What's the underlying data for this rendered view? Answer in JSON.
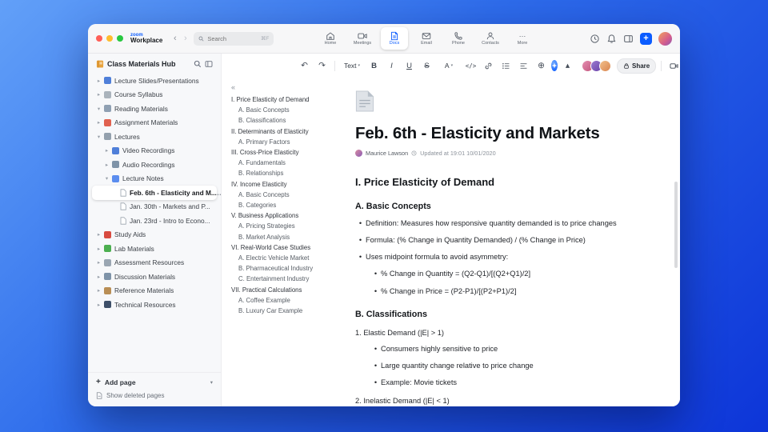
{
  "colors": {
    "accent": "#0b5cff"
  },
  "header": {
    "brand_top": "zoom",
    "brand_bottom": "Workplace",
    "search_placeholder": "Search",
    "search_shortcut": "⌘F"
  },
  "nav": {
    "items": [
      {
        "label": "Home"
      },
      {
        "label": "Meetings"
      },
      {
        "label": "Docs",
        "active": true
      },
      {
        "label": "Email"
      },
      {
        "label": "Phone"
      },
      {
        "label": "Contacts"
      },
      {
        "label": "More"
      }
    ]
  },
  "icons": {
    "chevron_right": "▸",
    "chevron_down": "▾",
    "chevron_up": "▴",
    "back": "‹",
    "forward": "›",
    "undo": "↶",
    "redo": "↷",
    "ellipsis": "…",
    "collapse_outline": "«",
    "plus": "+",
    "insert": "⊕",
    "bold": "B",
    "italic": "I",
    "underline": "U",
    "strike": "S",
    "font_color": "A",
    "code": "</>"
  },
  "sidebar": {
    "title": "Class Materials Hub",
    "items": [
      {
        "label": "Lecture Slides/Presentations",
        "icon": "presentation"
      },
      {
        "label": "Course Syllabus",
        "icon": "clipboard"
      },
      {
        "label": "Reading Materials",
        "icon": "book",
        "expanded": true
      },
      {
        "label": "Assignment Materials",
        "icon": "magnet"
      },
      {
        "label": "Lectures",
        "icon": "tag",
        "expanded": true
      },
      {
        "label": "Video Recordings",
        "icon": "video"
      },
      {
        "label": "Audio Recordings",
        "icon": "microphone"
      },
      {
        "label": "Lecture Notes",
        "icon": "note",
        "expanded": true
      },
      {
        "label": "Feb. 6th - Elasticity and M...",
        "icon": "page",
        "selected": true
      },
      {
        "label": "Jan. 30th - Markets and P...",
        "icon": "page"
      },
      {
        "label": "Jan. 23rd - Intro to Econo...",
        "icon": "page"
      },
      {
        "label": "Study Aids",
        "icon": "apple"
      },
      {
        "label": "Lab Materials",
        "icon": "pencil"
      },
      {
        "label": "Assessment Resources",
        "icon": "assessment"
      },
      {
        "label": "Discussion Materials",
        "icon": "discussion"
      },
      {
        "label": "Reference Materials",
        "icon": "reference"
      },
      {
        "label": "Technical Resources",
        "icon": "technical"
      }
    ],
    "add_page": "Add page",
    "show_deleted": "Show deleted pages"
  },
  "toolbar": {
    "text_style": "Text",
    "share": "Share"
  },
  "doc": {
    "title": "Feb. 6th - Elasticity and Markets",
    "author": "Maurice Lawson",
    "updated": "Updated at 19:01 10/01/2020"
  },
  "outline": {
    "items": [
      {
        "label": "I. Price Elasticity of Demand",
        "level": 1
      },
      {
        "label": "A. Basic Concepts",
        "level": 2
      },
      {
        "label": "B. Classifications",
        "level": 2
      },
      {
        "label": "II. Determinants of Elasticity",
        "level": 1
      },
      {
        "label": "A. Primary Factors",
        "level": 2
      },
      {
        "label": "III. Cross-Price Elasticity",
        "level": 1
      },
      {
        "label": "A. Fundamentals",
        "level": 2
      },
      {
        "label": "B. Relationships",
        "level": 2
      },
      {
        "label": "IV. Income Elasticity",
        "level": 1
      },
      {
        "label": "A. Basic Concepts",
        "level": 2
      },
      {
        "label": "B. Categories",
        "level": 2
      },
      {
        "label": "V. Business Applications",
        "level": 1
      },
      {
        "label": "A. Pricing Strategies",
        "level": 2
      },
      {
        "label": "B. Market Analysis",
        "level": 2
      },
      {
        "label": "VI. Real-World Case Studies",
        "level": 1
      },
      {
        "label": "A. Electric Vehicle Market",
        "level": 2
      },
      {
        "label": "B. Pharmaceutical Industry",
        "level": 2
      },
      {
        "label": "C. Entertainment Industry",
        "level": 2
      },
      {
        "label": "VII. Practical Calculations",
        "level": 1
      },
      {
        "label": "A. Coffee Example",
        "level": 2
      },
      {
        "label": "B. Luxury Car Example",
        "level": 2
      }
    ]
  },
  "content": {
    "h1": "I. Price Elasticity of Demand",
    "a_heading": "A. Basic Concepts",
    "a_bullets": [
      "Definition: Measures how responsive quantity demanded is to price changes",
      "Formula: (% Change in Quantity Demanded) / (% Change in Price)",
      "Uses midpoint formula to avoid asymmetry:"
    ],
    "a_sub": [
      "% Change in Quantity = (Q2-Q1)/[(Q2+Q1)/2]",
      "% Change in Price = (P2-P1)/[(P2+P1)/2]"
    ],
    "b_heading": "B. Classifications",
    "b_items": [
      {
        "text": "1. Elastic Demand (|E| > 1)"
      },
      {
        "text": "2. Inelastic Demand (|E| < 1)"
      }
    ],
    "b1_bullets": [
      "Consumers highly sensitive to price",
      "Large quantity change relative to price change",
      "Example: Movie tickets"
    ]
  }
}
